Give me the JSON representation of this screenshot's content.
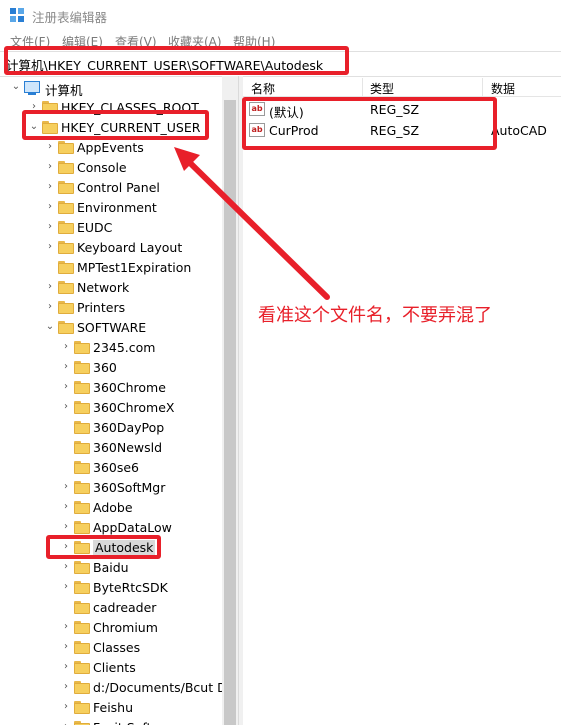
{
  "window": {
    "title": "注册表编辑器"
  },
  "menu": [
    "文件(F)",
    "编辑(E)",
    "查看(V)",
    "收藏夹(A)",
    "帮助(H)"
  ],
  "address": "计算机\\HKEY_CURRENT_USER\\SOFTWARE\\Autodesk",
  "tree": {
    "root": "计算机",
    "hkcr": "HKEY_CLASSES_ROOT",
    "hkcu": "HKEY_CURRENT_USER",
    "hkcu_children": [
      "AppEvents",
      "Console",
      "Control Panel",
      "Environment",
      "EUDC",
      "Keyboard Layout",
      "MPTest1Expiration",
      "Network",
      "Printers",
      "SOFTWARE"
    ],
    "software_children": [
      "2345.com",
      "360",
      "360Chrome",
      "360ChromeX",
      "360DayPop",
      "360Newsld",
      "360se6",
      "360SoftMgr",
      "Adobe",
      "AppDataLow",
      "Autodesk",
      "Baidu",
      "ByteRtcSDK",
      "cadreader",
      "Chromium",
      "Classes",
      "Clients",
      "d:/Documents/Bcut Dr",
      "Feishu",
      "Foxit Software"
    ]
  },
  "list": {
    "headers": {
      "name": "名称",
      "type": "类型",
      "data": "数据"
    },
    "rows": [
      {
        "name": "(默认)",
        "type": "REG_SZ",
        "data": ""
      },
      {
        "name": "CurProd",
        "type": "REG_SZ",
        "data": "AutoCAD"
      }
    ],
    "icon_text": "ab"
  },
  "annotation": {
    "text": "看准这个文件名，不要弄混了",
    "color": "#e8202a"
  }
}
